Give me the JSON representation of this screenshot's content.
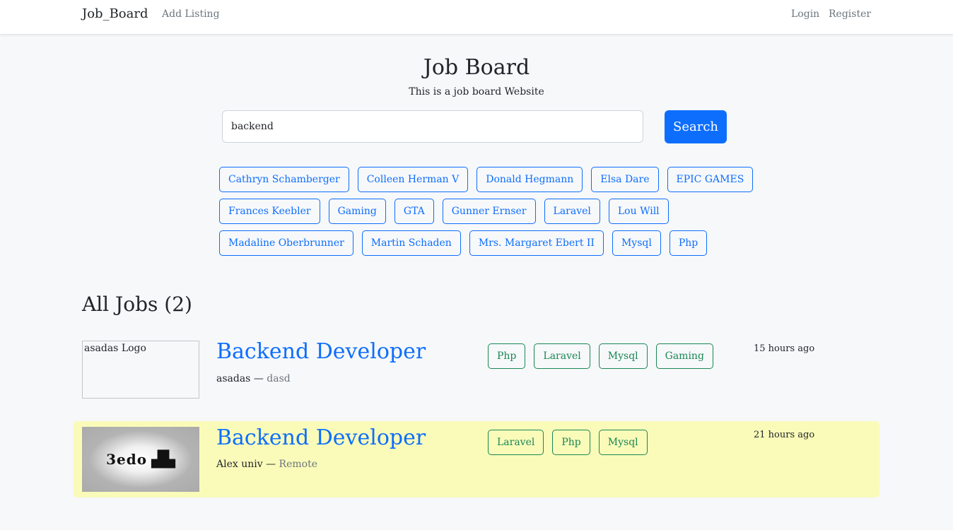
{
  "nav": {
    "brand": "Job_Board",
    "add_listing": "Add Listing",
    "login": "Login",
    "register": "Register"
  },
  "hero": {
    "title": "Job Board",
    "subtitle": "This is a job board Website"
  },
  "search": {
    "value": "backend",
    "button_label": "Search"
  },
  "tag_rows": [
    [
      "Cathryn Schamberger",
      "Colleen Herman V",
      "Donald Hegmann",
      "Elsa Dare",
      "EPIC GAMES"
    ],
    [
      "Frances Keebler",
      "Gaming",
      "GTA",
      "Gunner Ernser",
      "Laravel",
      "Lou Will"
    ],
    [
      "Madaline Oberbrunner",
      "Martin Schaden",
      "Mrs. Margaret Ebert II",
      "Mysql",
      "Php"
    ]
  ],
  "jobs_heading": "All Jobs (2)",
  "jobs": [
    {
      "logo_alt": "asadas Logo",
      "title": "Backend Developer",
      "company": "asadas",
      "separator": "—",
      "location": "dasd",
      "tags": [
        "Php",
        "Laravel",
        "Mysql",
        "Gaming"
      ],
      "posted": "15 hours ago",
      "featured": false
    },
    {
      "logo_text": "3edo",
      "title": "Backend Developer",
      "company": "Alex univ",
      "separator": "—",
      "location": "Remote",
      "tags": [
        "Laravel",
        "Php",
        "Mysql"
      ],
      "posted": "21 hours ago",
      "featured": true
    }
  ],
  "colors": {
    "primary": "#0d6efd",
    "success": "#198754",
    "featured_bg": "#fafbb9",
    "page_bg": "#f7f8fa"
  }
}
